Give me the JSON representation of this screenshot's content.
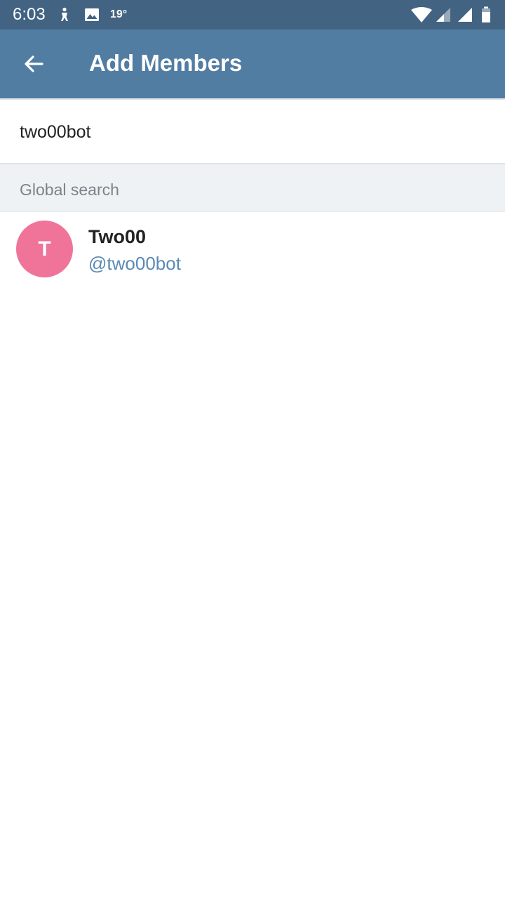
{
  "status_bar": {
    "time": "6:03",
    "temperature": "19°",
    "icons": [
      "person-notification-icon",
      "image-notification-icon",
      "wifi-icon",
      "cellular-signal-icon",
      "cellular-signal-icon",
      "battery-icon"
    ]
  },
  "app_bar": {
    "title": "Add Members",
    "back_icon": "arrow-back-icon",
    "color": "#527da3"
  },
  "search": {
    "value": "two00bot"
  },
  "section": {
    "label": "Global search"
  },
  "results": [
    {
      "avatar_letter": "T",
      "avatar_color": "#f07399",
      "name": "Two00",
      "username": "@two00bot"
    }
  ]
}
